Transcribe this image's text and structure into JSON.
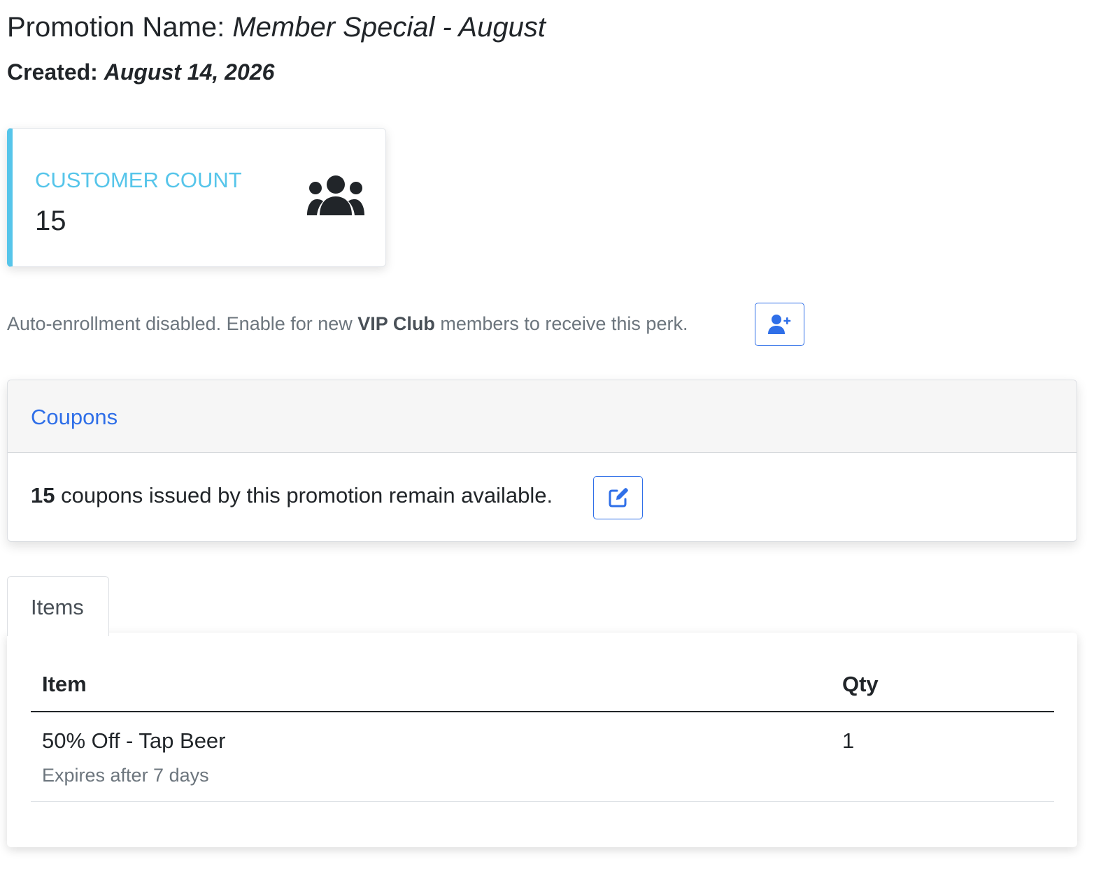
{
  "promotion": {
    "name_label": "Promotion Name:",
    "name_value": "Member Special - August",
    "created_label": "Created:",
    "created_value": "August 14, 2026"
  },
  "customer_count_card": {
    "label": "CUSTOMER COUNT",
    "value": "15",
    "icon": "users-icon",
    "accent_color": "#56c5ea"
  },
  "auto_enrollment": {
    "text_before": "Auto-enrollment disabled. Enable for new ",
    "club_name": "VIP Club",
    "text_after": " members to receive this perk.",
    "button_icon": "user-plus-icon"
  },
  "coupons": {
    "header": "Coupons",
    "count": "15",
    "text": " coupons issued by this promotion remain available.",
    "button_icon": "edit-icon"
  },
  "tabs": [
    {
      "label": "Items",
      "active": true
    }
  ],
  "items_table": {
    "columns": [
      "Item",
      "Qty"
    ],
    "rows": [
      {
        "name": "50% Off - Tap Beer",
        "detail": "Expires after 7 days",
        "qty": "1"
      }
    ]
  },
  "colors": {
    "primary": "#2f6fe8",
    "info": "#56c5ea",
    "muted": "#6c757d",
    "text": "#212529"
  }
}
